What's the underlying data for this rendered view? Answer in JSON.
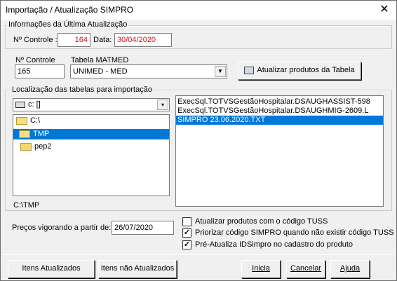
{
  "window": {
    "title": "Importação / Atualização SIMPRO",
    "close_glyph": "✕"
  },
  "last_update": {
    "group_label": "Informações da Última Atualização",
    "controle_label": "Nº Controle :",
    "controle_value": "164",
    "data_label": "Data:",
    "data_value": "30/04/2020"
  },
  "controle": {
    "label": "Nº Controle",
    "value": "165"
  },
  "tabela": {
    "label": "Tabela MATMED",
    "value": "UNIMED - MED"
  },
  "update_table_button": {
    "label": "Atualizar produtos da Tabela",
    "icon": "update-icon"
  },
  "location": {
    "group_label": "Localização das tabelas para importação",
    "drive_value": "c: []",
    "folders": [
      {
        "label": "C:\\",
        "indent": 0,
        "selected": false
      },
      {
        "label": "TMP",
        "indent": 1,
        "selected": true
      },
      {
        "label": "pep2",
        "indent": 2,
        "selected": false
      }
    ],
    "current_path": "C:\\TMP",
    "files": [
      {
        "label": "ExecSql.TOTVSGestãoHospitalar.DSAUGHASSIST-598",
        "selected": false
      },
      {
        "label": "ExecSql.TOTVSGestãoHospitalar.DSAUGHMIG-2609.L",
        "selected": false
      },
      {
        "label": "SIMPRO 23.06.2020.TXT",
        "selected": true
      }
    ]
  },
  "precos": {
    "label": "Preços vigorando a partir de:",
    "value": "26/07/2020"
  },
  "options": [
    {
      "label": "Atualizar produtos com o código TUSS",
      "checked": false
    },
    {
      "label": "Priorizar código SIMPRO quando não existir código TUSS",
      "checked": true
    },
    {
      "label": "Pré-Atualiza IDSimpro no cadastro do produto",
      "checked": true
    }
  ],
  "buttons": {
    "itens_atualizados": "Itens Atualizados",
    "itens_nao_atualizados": "Itens não Atualizados",
    "inicia": "Inicia",
    "cancelar": "Cancelar",
    "ajuda": "Ajuda"
  }
}
